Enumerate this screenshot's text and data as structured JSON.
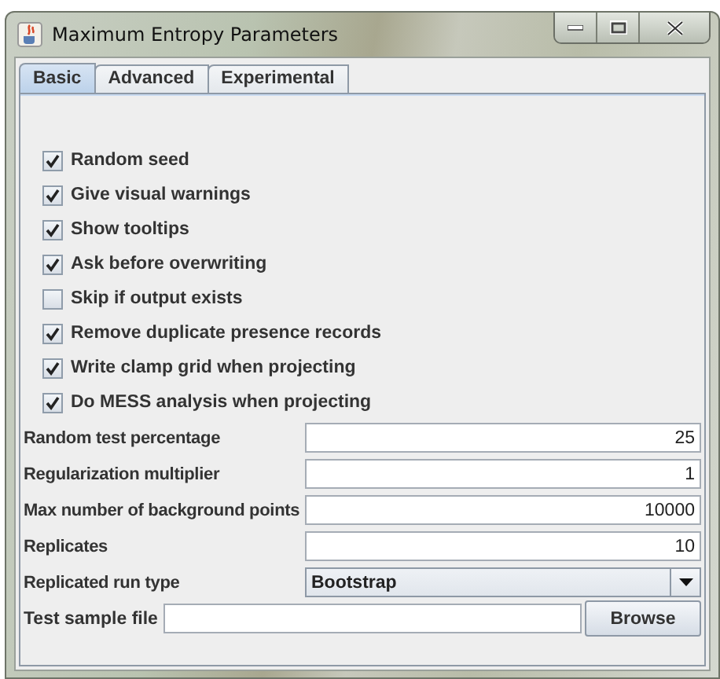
{
  "window": {
    "title": "Maximum Entropy Parameters"
  },
  "tabs": [
    {
      "label": "Basic",
      "selected": true
    },
    {
      "label": "Advanced",
      "selected": false
    },
    {
      "label": "Experimental",
      "selected": false
    }
  ],
  "options": [
    {
      "label": "Random seed",
      "checked": true
    },
    {
      "label": "Give visual warnings",
      "checked": true
    },
    {
      "label": "Show tooltips",
      "checked": true
    },
    {
      "label": "Ask before overwriting",
      "checked": true
    },
    {
      "label": "Skip if output exists",
      "checked": false
    },
    {
      "label": "Remove duplicate presence records",
      "checked": true
    },
    {
      "label": "Write clamp grid when projecting",
      "checked": true
    },
    {
      "label": "Do MESS analysis when projecting",
      "checked": true
    }
  ],
  "settings": [
    {
      "kind": "number",
      "label": "Random test percentage",
      "value": "25"
    },
    {
      "kind": "number",
      "label": "Regularization multiplier",
      "value": "1"
    },
    {
      "kind": "number",
      "label": "Max number of background points",
      "value": "10000"
    },
    {
      "kind": "number",
      "label": "Replicates",
      "value": "10"
    },
    {
      "kind": "dropdown",
      "label": "Replicated run type",
      "value": "Bootstrap"
    },
    {
      "kind": "file",
      "label": "Test sample file",
      "button": "Browse"
    }
  ]
}
